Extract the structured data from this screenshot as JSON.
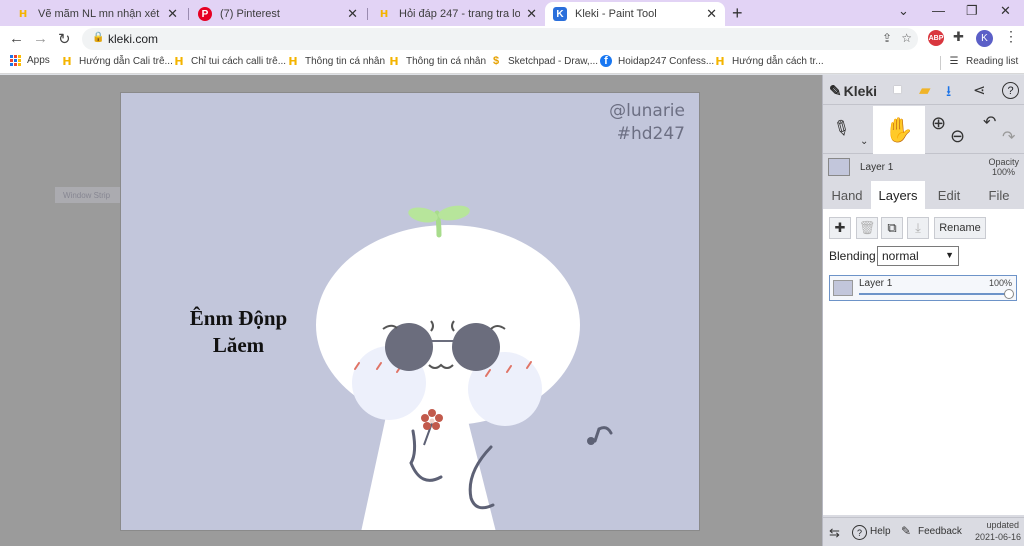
{
  "browser": {
    "tabs": [
      {
        "title": "Vẽ mãm NL mn nhận xét giúp mình",
        "icon": "hoidap-favicon"
      },
      {
        "title": "(7) Pinterest",
        "icon": "pinterest-favicon"
      },
      {
        "title": "Hỏi đáp 247 - trang tra loi",
        "icon": "hoidap-favicon"
      },
      {
        "title": "Kleki - Paint Tool",
        "icon": "kleki-favicon"
      }
    ],
    "active_tab": 3,
    "url": "kleki.com",
    "avatar_initial": "K",
    "abp_label": "ABP",
    "bookmarks": [
      {
        "label": "Apps"
      },
      {
        "label": "Hướng dẫn Cali trê..."
      },
      {
        "label": "Chỉ tui cách calli trê..."
      },
      {
        "label": "Thông tin cá nhân"
      },
      {
        "label": "Thông tin cá nhân"
      },
      {
        "label": "Sketchpad - Draw,..."
      },
      {
        "label": "Hoidap247 Confess..."
      },
      {
        "label": "Hướng dẫn cách tr..."
      }
    ],
    "reading_list": "Reading list",
    "colors": {
      "tab_strip": "#e2d3f5",
      "accent": "#1a73e8"
    }
  },
  "workspace": {
    "window_strip": "Window Strip",
    "canvas": {
      "watermark_1": "@lunarie",
      "watermark_2": "#hd247",
      "text_line_1": "Ênm Độnp",
      "text_line_2": "Lăem",
      "background": "#c2c6db"
    }
  },
  "kleki": {
    "logo": "Kleki",
    "current_layer": "Layer 1",
    "opacity_label": "Opacity",
    "opacity_value": "100%",
    "tabs": [
      {
        "label": "Hand"
      },
      {
        "label": "Layers"
      },
      {
        "label": "Edit"
      },
      {
        "label": "File"
      }
    ],
    "active_tab": 1,
    "rename_label": "Rename",
    "blending_label": "Blending",
    "blending_value": "normal",
    "layers": [
      {
        "name": "Layer 1",
        "opacity": "100%",
        "opacity_fraction": 1.0
      }
    ],
    "footer": {
      "help": "Help",
      "feedback": "Feedback",
      "updated_label": "updated",
      "updated_date": "2021-06-16"
    }
  }
}
